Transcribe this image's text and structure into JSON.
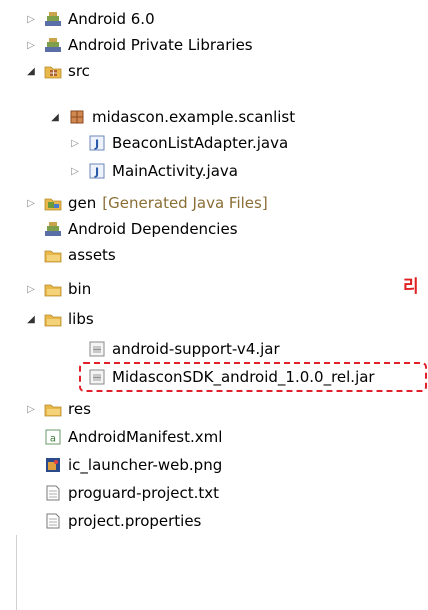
{
  "tree": {
    "items": [
      {
        "label": "Android 6.0"
      },
      {
        "label": "Android Private Libraries"
      },
      {
        "label": "src"
      },
      {
        "label": "midascon.example.scanlist"
      },
      {
        "label": "BeaconListAdapter.java"
      },
      {
        "label": "MainActivity.java"
      },
      {
        "label": "gen",
        "decoration": "[Generated Java Files]"
      },
      {
        "label": "Android Dependencies"
      },
      {
        "label": "assets"
      },
      {
        "label": "bin"
      },
      {
        "label": "libs"
      },
      {
        "label": "android-support-v4.jar"
      },
      {
        "label": "MidasconSDK_android_1.0.0_rel.jar"
      },
      {
        "label": "res"
      },
      {
        "label": "AndroidManifest.xml"
      },
      {
        "label": "ic_launcher-web.png"
      },
      {
        "label": "proguard-project.txt"
      },
      {
        "label": "project.properties"
      }
    ]
  },
  "annotation": {
    "text": "리"
  },
  "colors": {
    "highlight": "#e0202a",
    "folder": "#e8b84a",
    "java": "#2a5aa8"
  }
}
